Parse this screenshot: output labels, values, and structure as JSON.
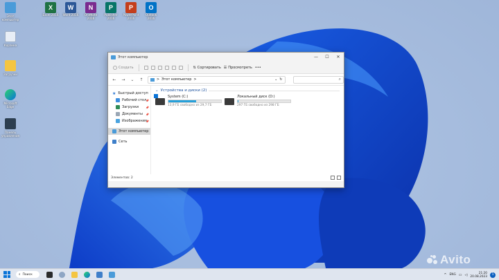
{
  "colors": {
    "accent": "#0a74d8",
    "drive_bar": "#26a0da",
    "group_header": "#1a4f9c"
  },
  "desktop": {
    "left_icons": [
      {
        "label": "Этот компьютер",
        "icon": "computer-icon"
      },
      {
        "label": "Корзина",
        "icon": "recycle-bin-icon"
      },
      {
        "label": "Загрузки",
        "icon": "folder-icon"
      },
      {
        "label": "Microsoft Edge",
        "icon": "edge-icon"
      },
      {
        "label": "Панель управления",
        "icon": "control-panel-icon"
      }
    ],
    "top_icons": [
      {
        "label": "Excel 2016",
        "letter": "X",
        "color": "#1f7244"
      },
      {
        "label": "Word 2016",
        "letter": "W",
        "color": "#2b5797"
      },
      {
        "label": "OneNote 2016",
        "letter": "N",
        "color": "#7a2b8f"
      },
      {
        "label": "Publisher 2016",
        "letter": "P",
        "color": "#077568"
      },
      {
        "label": "PowerPoint 2016",
        "letter": "P",
        "color": "#c43e1c"
      },
      {
        "label": "Outlook 2016",
        "letter": "O",
        "color": "#0072c6"
      }
    ]
  },
  "window": {
    "title": "Этот компьютер",
    "controls": {
      "minimize": "—",
      "maximize": "☐",
      "close": "✕"
    },
    "cmdbar": {
      "new_label": "Создать",
      "sort_label": "Сортировать",
      "view_label": "Просмотреть",
      "more_label": "•••"
    },
    "address": {
      "path": "Этот компьютер",
      "chevron": ">",
      "dropdown": "⌄",
      "refresh": "↻"
    },
    "nav": {
      "back": "←",
      "forward": "→",
      "dropdown": "⌄",
      "up": "↑"
    },
    "search_icon": "⌕",
    "nav_pane": {
      "quick_access": "Быстрый доступ",
      "pinned": [
        "Рабочий стол",
        "Загрузки",
        "Документы",
        "Изображения"
      ],
      "this_pc": "Этот компьютер",
      "network": "Сеть"
    },
    "group": {
      "title": "Устройства и диски (2)"
    },
    "drives": [
      {
        "name": "System (C:)",
        "free": "13,9 ГБ свободно из 29,7 ГБ",
        "used_fraction": 0.53
      },
      {
        "name": "Локальный диск (D:)",
        "free": "297 ГБ свободно из 298 ГБ",
        "used_fraction": 0.004
      }
    ],
    "status": "Элементов: 2"
  },
  "taskbar": {
    "search_label": "Поиск",
    "lang": "ENG",
    "time": "21:20",
    "date": "20.08.2023",
    "notifications": "1"
  },
  "watermark": "Avito"
}
